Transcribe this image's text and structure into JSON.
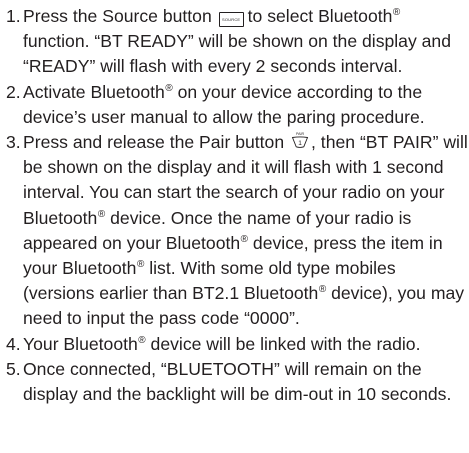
{
  "steps": [
    {
      "num": "1.",
      "parts": {
        "a": "Press the Source button",
        "button_label": "SOURCE",
        "b": "to select Bluetooth",
        "reg1": "®",
        "c": "function. “BT READY” will be shown on the display and “READY” will flash with every 2 seconds interval."
      }
    },
    {
      "num": "2.",
      "parts": {
        "a": "Activate Bluetooth",
        "reg1": "®",
        "b": " on your device according to the device’s user manual to allow the paring procedure."
      }
    },
    {
      "num": "3.",
      "parts": {
        "a": "Press and release the Pair button",
        "icon_label": "PAIR",
        "b": ", then “BT PAIR” will be shown on the display and it will flash with 1 second interval. You can start the search of your radio on your Bluetooth",
        "reg1": "®",
        "c": " device. Once the name of your radio is appeared on your Bluetooth",
        "reg2": "®",
        "d": " device, press the item in your Bluetooth",
        "reg3": "®",
        "e": " list. With some old type mobiles (versions earlier than BT2.1 Bluetooth",
        "reg4": "®",
        "f": " device), you may need to input the pass code “0000”."
      }
    },
    {
      "num": "4.",
      "parts": {
        "a": "Your Bluetooth",
        "reg1": "®",
        "b": " device will be linked with the radio."
      }
    },
    {
      "num": "5.",
      "parts": {
        "a": "Once connected, “BLUETOOTH” will remain on the display and the backlight will be dim-out in 10 seconds."
      }
    }
  ]
}
